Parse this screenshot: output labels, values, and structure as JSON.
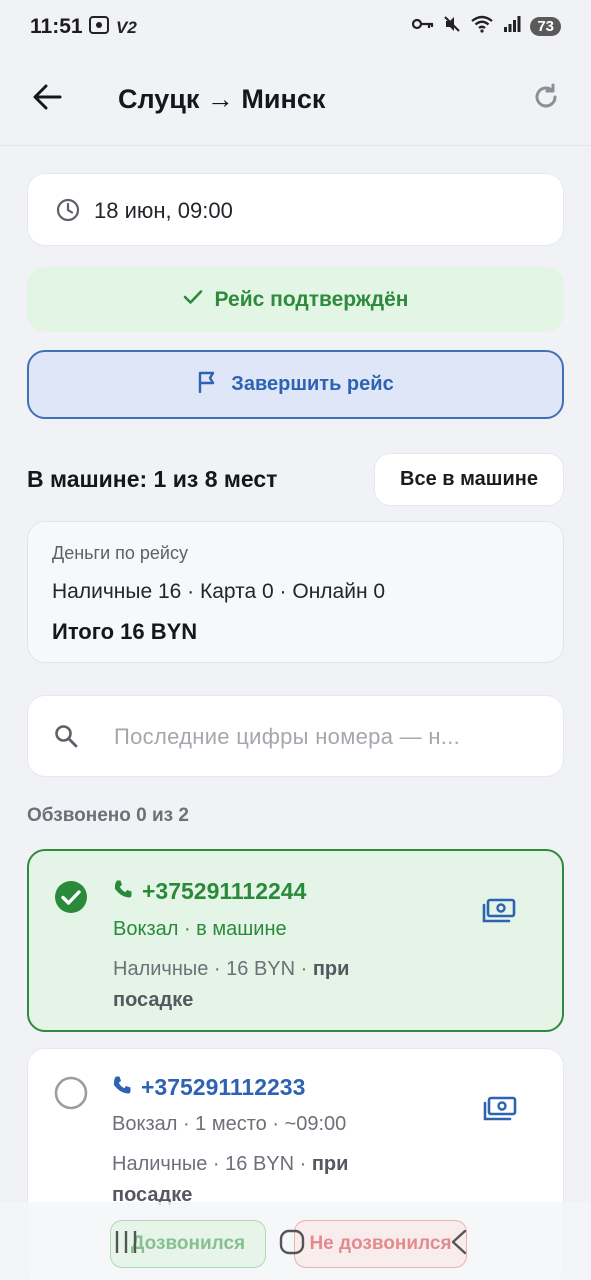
{
  "status_bar": {
    "time": "11:51",
    "left_badge": "V2",
    "battery": "73"
  },
  "header": {
    "title": "Слуцк → Минск"
  },
  "trip": {
    "datetime": "18 июн, 09:00",
    "status": "Рейс подтверждён",
    "finish_label": "Завершить рейс"
  },
  "occupancy": {
    "label": "В машине: 1 из 8 мест",
    "all_in_label": "Все в машине"
  },
  "money": {
    "title": "Деньги по рейсу",
    "breakdown": "Наличные 16 · Карта 0 · Онлайн 0",
    "total": "Итого 16 BYN"
  },
  "search": {
    "placeholder": "Последние цифры номера — н..."
  },
  "called_summary": "Обзвонено 0 из 2",
  "passengers": [
    {
      "phone": "+375291112244",
      "details": "Вокзал · в машине",
      "payment": "Наличные · 16 BYN · ",
      "payment_when": "при посадке",
      "checked": true
    },
    {
      "phone": "+375291112233",
      "details": "Вокзал · 1 место · ~09:00",
      "payment": "Наличные · 16 BYN · ",
      "payment_when": "при посадке",
      "checked": false
    }
  ],
  "actions": {
    "called_label": "Дозвонился",
    "not_called_label": "Не дозвонился"
  },
  "colors": {
    "accent_blue": "#2d63b2",
    "success_green": "#2a8a3a",
    "background": "#f1f2f6"
  }
}
